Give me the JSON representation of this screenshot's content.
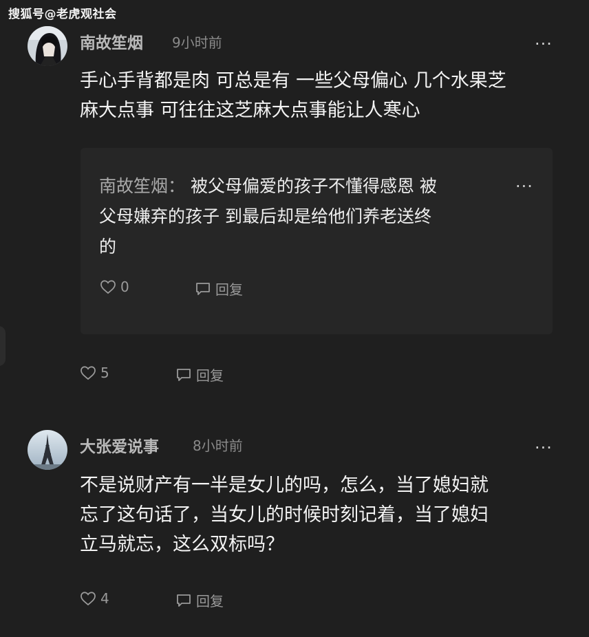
{
  "watermark": "搜狐号@老虎观社会",
  "comments": [
    {
      "username": "南故笙烟",
      "time": "9小时前",
      "more": "···",
      "text_lines": [
        "手心手背都是肉 可总是有 一些父母偏心 几个水果芝",
        "麻大点事 可往往这芝麻大点事能让人寒心"
      ],
      "reply": {
        "username": "南故笙烟：",
        "text_first": "被父母偏爱的孩子不懂得感恩 被",
        "text_lines": [
          "父母嫌弃的孩子 到最后却是给他们养老送终",
          "的"
        ],
        "more": "···",
        "likes": "0",
        "reply_label": "回复"
      },
      "likes": "5",
      "reply_label": "回复"
    },
    {
      "username": "大张爱说事",
      "time": "8小时前",
      "more": "···",
      "text_lines": [
        "不是说财产有一半是女儿的吗，怎么，当了媳妇就",
        "忘了这句话了，当女儿的时候时刻记着，当了媳妇",
        "立马就忘，这么双标吗？"
      ],
      "likes": "4",
      "reply_label": "回复"
    }
  ],
  "icons": {
    "like": "heart-outline-icon",
    "reply": "comment-bubble-icon",
    "more": "more-dots-icon"
  },
  "colors": {
    "background": "#1f1f1f",
    "reply_box": "#262626",
    "text": "#f3f3f3",
    "muted": "#9a9a9a"
  }
}
